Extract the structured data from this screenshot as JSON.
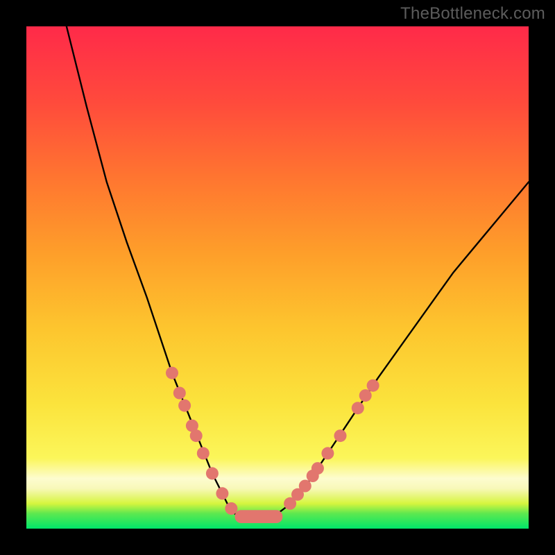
{
  "watermark": "TheBottleneck.com",
  "chart_data": {
    "type": "line",
    "title": "",
    "xlabel": "",
    "ylabel": "",
    "xlim": [
      0,
      100
    ],
    "ylim": [
      0,
      100
    ],
    "series": [
      {
        "name": "bottleneck-curve",
        "x": [
          8,
          12,
          16,
          20,
          24,
          27,
          29,
          31,
          33,
          35,
          37,
          39,
          40.5,
          42,
          44,
          46,
          48,
          50,
          52,
          55,
          58,
          62,
          66,
          70,
          75,
          80,
          85,
          90,
          95,
          100
        ],
        "values": [
          100,
          84,
          69,
          57,
          46,
          37,
          31,
          26,
          21,
          16,
          11,
          7,
          4,
          2.5,
          2,
          2,
          2,
          3,
          4.5,
          7.5,
          12,
          18,
          24,
          30,
          37,
          44,
          51,
          57,
          63,
          69
        ]
      }
    ],
    "markers": {
      "name": "highlight-dots",
      "color": "#e2766e",
      "points": [
        {
          "x": 29.0,
          "y": 31.0
        },
        {
          "x": 30.5,
          "y": 27.0
        },
        {
          "x": 31.5,
          "y": 24.5
        },
        {
          "x": 33.0,
          "y": 20.5
        },
        {
          "x": 33.8,
          "y": 18.5
        },
        {
          "x": 35.2,
          "y": 15.0
        },
        {
          "x": 37.0,
          "y": 11.0
        },
        {
          "x": 39.0,
          "y": 7.0
        },
        {
          "x": 40.8,
          "y": 4.0
        },
        {
          "x": 52.5,
          "y": 5.0
        },
        {
          "x": 54.0,
          "y": 6.8
        },
        {
          "x": 55.5,
          "y": 8.5
        },
        {
          "x": 57.0,
          "y": 10.5
        },
        {
          "x": 58.0,
          "y": 12.0
        },
        {
          "x": 60.0,
          "y": 15.0
        },
        {
          "x": 62.5,
          "y": 18.5
        },
        {
          "x": 66.0,
          "y": 24.0
        },
        {
          "x": 67.5,
          "y": 26.5
        },
        {
          "x": 69.0,
          "y": 28.5
        }
      ]
    },
    "trough_bar": {
      "name": "optimal-range",
      "color": "#e2766e",
      "x_start": 41.5,
      "x_end": 51.0,
      "y": 2.4,
      "thickness": 2.6
    }
  }
}
